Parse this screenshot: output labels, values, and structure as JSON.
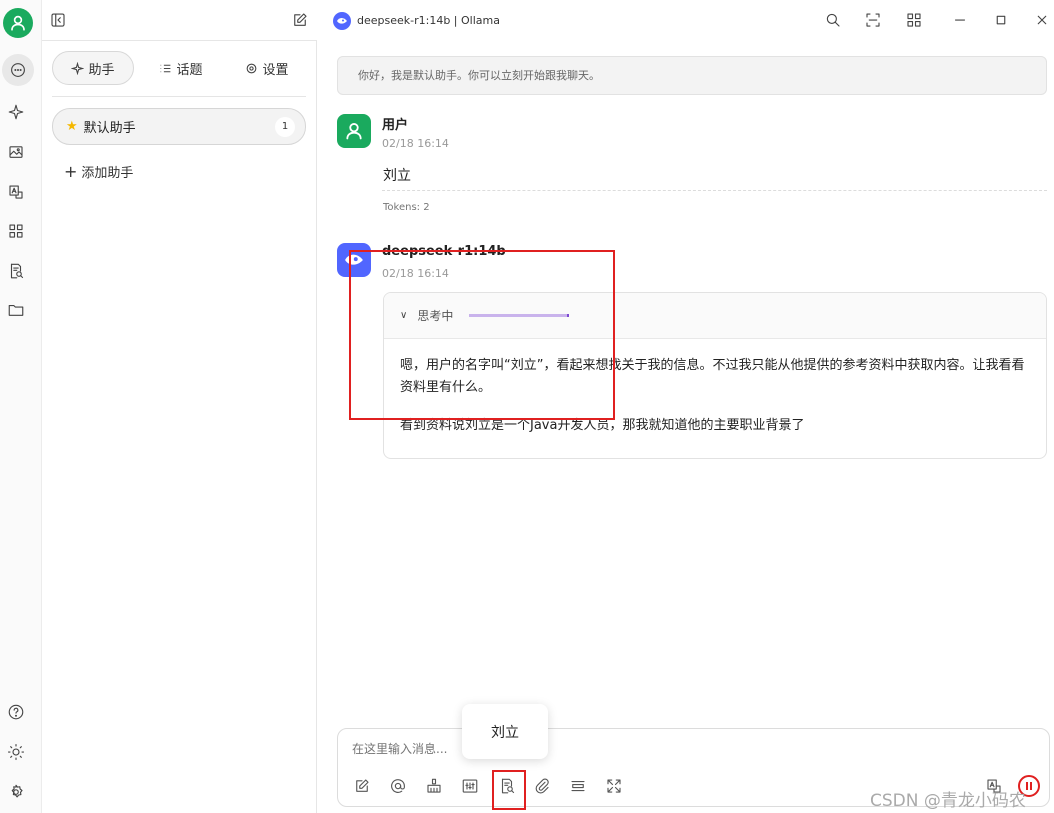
{
  "window": {
    "title": "deepseek-r1:14b | Ollama"
  },
  "sidebar": {
    "tabs": [
      {
        "label": "助手"
      },
      {
        "label": "话题"
      },
      {
        "label": "设置"
      }
    ],
    "assistant": {
      "name": "默认助手",
      "count": "1"
    },
    "add_label": "添加助手"
  },
  "chat": {
    "system_notice": "你好，我是默认助手。你可以立刻开始跟我聊天。",
    "user_msg": {
      "name": "用户",
      "time": "02/18 16:14",
      "text": "刘立",
      "tokens": "Tokens: 2"
    },
    "bot_msg": {
      "name": "deepseek-r1:14b",
      "time": "02/18 16:14",
      "thinking_label": "思考中",
      "para1": "嗯，用户的名字叫“刘立”，看起来想找关于我的信息。不过我只能从他提供的参考资料中获取内容。让我看看资料里有什么。",
      "para2": "看到资料说刘立是一个Java开发人员，那我就知道他的主要职业背景了"
    }
  },
  "input": {
    "placeholder": "在这里输入消息...",
    "tooltip": "刘立"
  },
  "watermark": "CSDN @青龙小码农",
  "colors": {
    "accent": "#1aaa5e",
    "bot_avatar": "#5166ff",
    "highlight": "#e02020",
    "thinking_bar": "#c9b3ec"
  }
}
